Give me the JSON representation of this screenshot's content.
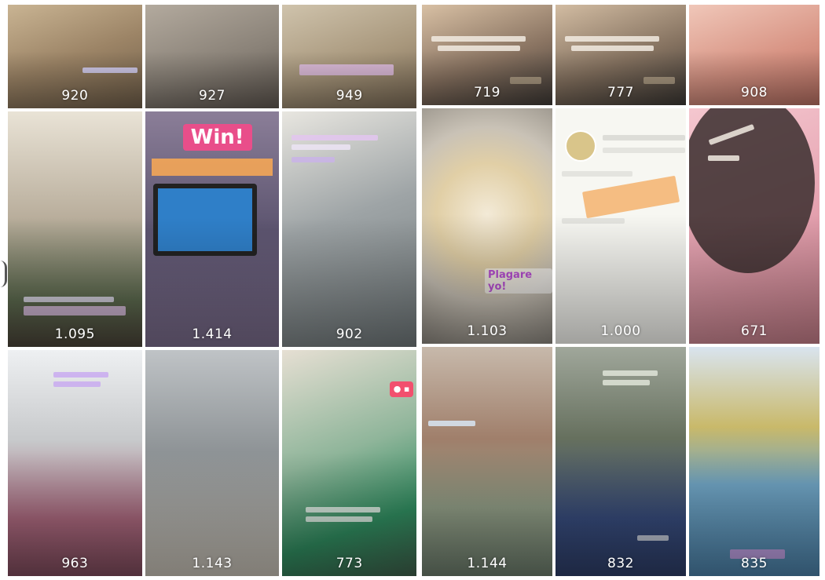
{
  "left_grid": {
    "tiles": [
      {
        "count": "920",
        "bg": "linear-gradient(160deg,#c9b493 0%,#9c8466 50%,#6f5e49 100%)"
      },
      {
        "count": "927",
        "bg": "linear-gradient(160deg,#b3aa9e 0%,#8a8278 55%,#5f5750 100%)"
      },
      {
        "count": "949",
        "bg": "linear-gradient(160deg,#cfc3ac 0%,#a8977c 55%,#7a6a55 100%)"
      },
      {
        "count": "1.095",
        "bg": "linear-gradient(180deg,#e9e3d6 0%,#b9ae9c 45%,#5d6b4f 80%,#4a4338 100%)"
      },
      {
        "count": "1.414",
        "bg": "linear-gradient(180deg,#8b7e98 0%,#5d5570 50%,#7b6d8c 100%)"
      },
      {
        "count": "902",
        "bg": "linear-gradient(160deg,#e8e6e0 0%,#9ea4a6 45%,#6f7779 100%)"
      },
      {
        "count": "963",
        "bg": "linear-gradient(180deg,#eef0f2 0%,#c7c9cb 40%,#a6657a 75%,#7d4a5b 100%)"
      },
      {
        "count": "1.143",
        "bg": "linear-gradient(180deg,#bfc3c6 0%,#8e9396 45%,#c6c0b5 100%)"
      },
      {
        "count": "773",
        "bg": "linear-gradient(160deg,#e6dfd3 0%,#8fb59a 45%,#2f8a5e 75%,#3f5e4a 100%)"
      }
    ],
    "win_label": "Win!",
    "live_icon": "heart-camera-icon"
  },
  "right_grid": {
    "tiles": [
      {
        "count": "719",
        "bg": "linear-gradient(160deg,#d8c0a4 0%,#8a7462 55%,#3f3a36 100%)"
      },
      {
        "count": "777",
        "bg": "linear-gradient(160deg,#d2bca2 0%,#857260 55%,#3c3834 100%)"
      },
      {
        "count": "908",
        "bg": "linear-gradient(160deg,#f0c7b9 0%,#d89484 55%,#b87063 100%)"
      },
      {
        "count": "1.103",
        "bg": "radial-gradient(circle at 50% 45%,#f3ead7 0%,#e1cfa6 35%,#c9c2b6 60%,#8a857d 100%)"
      },
      {
        "count": "1.000",
        "bg": "linear-gradient(180deg,#fbfaf5 0%,#f2efe6 60%,#e2a858 80%,#6f8a6c 100%)"
      },
      {
        "count": "671",
        "bg": "linear-gradient(160deg,#f4c7cf 0%,#e6a3b1 50%,#c47d88 100%)"
      },
      {
        "count": "1.144",
        "bg": "linear-gradient(180deg,#c7b9ab 0%,#a07f6b 40%,#8f9b84 70%,#6a7a6a 100%)"
      },
      {
        "count": "832",
        "bg": "linear-gradient(180deg,#a0a79b 0%,#66705e 40%,#364a7a 75%,#2d3d66 100%)"
      },
      {
        "count": "835",
        "bg": "linear-gradient(180deg,#d9e4ef 0%,#c9b96a 35%,#6fa3c2 60%,#4a7fa6 100%)"
      }
    ],
    "tag_text": "Plagare yo!"
  }
}
